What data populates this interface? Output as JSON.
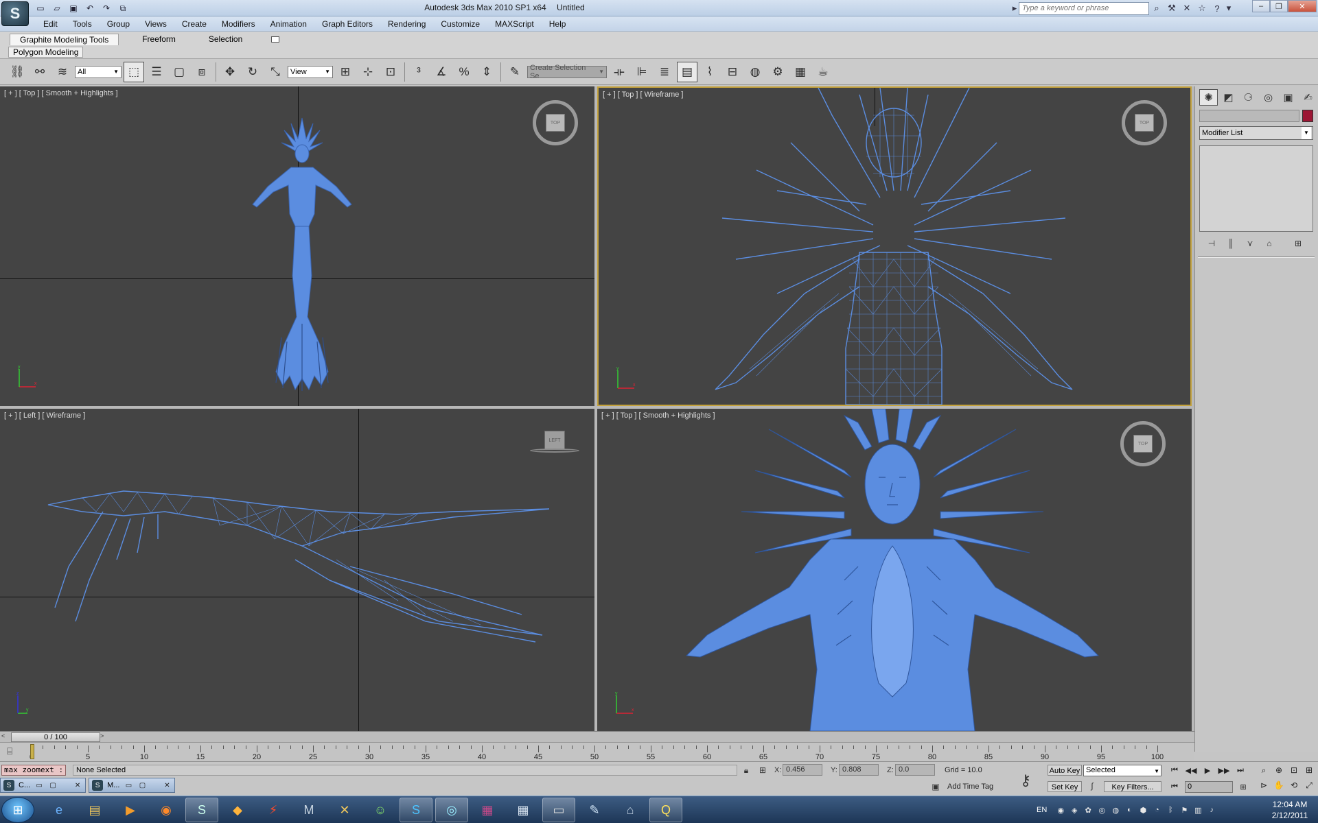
{
  "titlebar": {
    "app_title": "Autodesk 3ds Max  2010 SP1 x64",
    "doc_title": "Untitled",
    "search_placeholder": "Type a keyword or phrase",
    "logo_icon": "3dsmax-logo-icon"
  },
  "menubar": {
    "items": [
      "Edit",
      "Tools",
      "Group",
      "Views",
      "Create",
      "Modifiers",
      "Animation",
      "Graph Editors",
      "Rendering",
      "Customize",
      "MAXScript",
      "Help"
    ]
  },
  "ribbon": {
    "tabs": [
      "Graphite Modeling Tools",
      "Freeform",
      "Selection"
    ],
    "active_tab": "Graphite Modeling Tools",
    "panel_label": "Polygon Modeling"
  },
  "toolbar": {
    "filter_value": "All",
    "refcoord_value": "View",
    "named_selection_placeholder": "Create Selection Se"
  },
  "viewports": {
    "top_left": {
      "label": "[ + ] [ Top ] [ Smooth + Highlights ]",
      "cube_face": "TOP"
    },
    "top_right": {
      "label": "[ + ] [ Top ] [ Wireframe ]",
      "cube_face": "TOP"
    },
    "bottom_left": {
      "label": "[ + ] [ Left ] [ Wireframe ]",
      "cube_face": "LEFT"
    },
    "bottom_right": {
      "label": "[ + ] [ Top ] [ Smooth + Highlights ]",
      "cube_face": "TOP"
    },
    "active": "top_right",
    "model_color": "#5b8de0",
    "background_color": "#444444",
    "active_border_color": "#c4a23c"
  },
  "command_panel": {
    "modifier_list_label": "Modifier List",
    "object_color": "#9c1634"
  },
  "timeline": {
    "slider_label": "0 / 100",
    "current_frame": 0,
    "frame_count": 100,
    "tick_labels": [
      "0",
      "5",
      "10",
      "15",
      "20",
      "25",
      "30",
      "35",
      "40",
      "45",
      "50",
      "55",
      "60",
      "65",
      "70",
      "75",
      "80",
      "85",
      "90",
      "95",
      "100"
    ]
  },
  "status": {
    "listener_text": "max zoomext :",
    "selection_text": "None Selected",
    "x_label": "X:",
    "x_value": "0.456",
    "y_label": "Y:",
    "y_value": "0.808",
    "z_label": "Z:",
    "z_value": "0.0",
    "grid_text": "Grid = 10.0",
    "add_time_tag": "Add Time Tag",
    "auto_key": "Auto Key",
    "set_key": "Set Key",
    "selected_dropdown": "Selected",
    "key_filters": "Key Filters...",
    "frame_value": "0"
  },
  "minimized_windows": [
    {
      "label": "C...",
      "icon": "3dsmax-icon"
    },
    {
      "label": "M...",
      "icon": "3dsmax-icon"
    }
  ],
  "taskbar": {
    "apps": [
      "internet-explorer-icon",
      "file-explorer-icon",
      "media-player-icon",
      "firefox-icon",
      "3dsmax-icon",
      "goldfish-icon",
      "flashget-icon",
      "mudbox-icon",
      "xsi-icon",
      "messenger-icon",
      "skype-icon",
      "3dsmax-design-icon",
      "winrar-icon",
      "calculator-icon",
      "command-prompt-icon",
      "notepad-icon",
      "network-icon",
      "quicktime-icon"
    ],
    "language": "EN",
    "time": "12:04 AM",
    "date": "2/12/2011"
  }
}
